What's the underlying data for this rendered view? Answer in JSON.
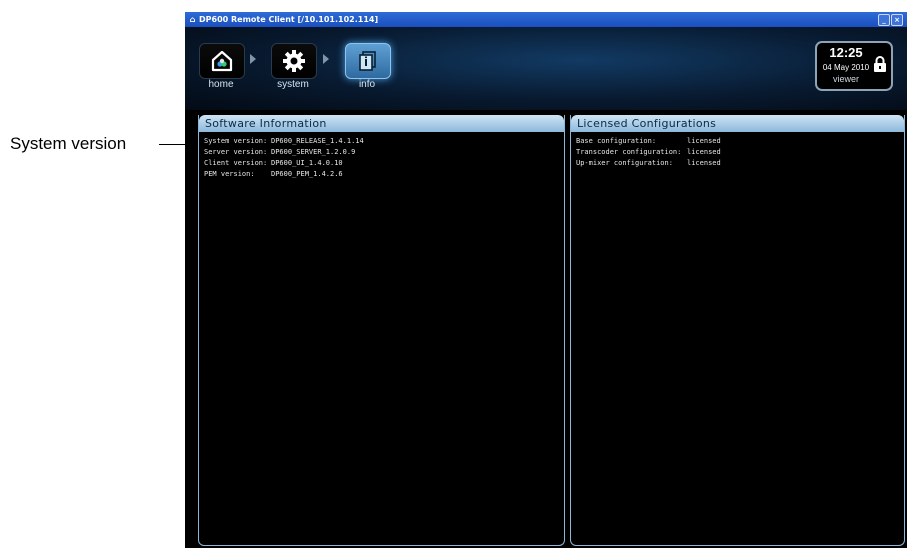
{
  "annotation": {
    "label": "System version"
  },
  "window": {
    "title": "DP600 Remote Client [/10.101.102.114]",
    "title_icon": "house-icon",
    "buttons": [
      "minimize",
      "close"
    ]
  },
  "nav": {
    "items": [
      {
        "label": "home",
        "icon": "home-icon",
        "active": false
      },
      {
        "label": "system",
        "icon": "gear-icon",
        "active": false
      },
      {
        "label": "info",
        "icon": "info-icon",
        "active": true
      }
    ]
  },
  "status": {
    "time": "12:25",
    "date": "04 May 2010",
    "user": "viewer",
    "icon": "lock-icon"
  },
  "software_info": {
    "title": "Software Information",
    "rows": [
      {
        "key": "System version:",
        "value": "DP600_RELEASE_1.4.1.14"
      },
      {
        "key": "Server version:",
        "value": "DP600_SERVER_1.2.0.9"
      },
      {
        "key": "Client version:",
        "value": "DP600_UI_1.4.0.10"
      },
      {
        "key": "PEM version:",
        "value": "DP600_PEM_1.4.2.6"
      }
    ]
  },
  "licensed_configs": {
    "title": "Licensed Configurations",
    "rows": [
      {
        "key": "Base configuration:",
        "value": "licensed"
      },
      {
        "key": "Transcoder configuration:",
        "value": "licensed"
      },
      {
        "key": "Up-mixer configuration:",
        "value": "licensed"
      }
    ]
  },
  "colors": {
    "titlebar": "#1f57c8",
    "panel_header": "#a9cbe6",
    "active_tab": "#4a8cc4"
  }
}
